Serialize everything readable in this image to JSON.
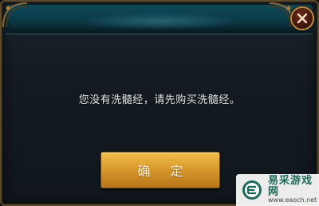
{
  "dialog": {
    "message": "您没有洗髓经，请先购买洗髓经。",
    "confirm_label": "确 定"
  },
  "watermark": {
    "title": "易采游戏网",
    "url": "www.eaoch.net"
  },
  "icons": {
    "close": "close-x-icon",
    "watermark_logo": "eaoch-logo-icon",
    "corner_ornaments": "ornament-icon"
  },
  "colors": {
    "header_teal": "#0f4a5a",
    "gold_button": "#d99b2c",
    "frame_gold": "#b58a48",
    "text": "#e8e8e8",
    "watermark_green": "#1e6a5a"
  }
}
